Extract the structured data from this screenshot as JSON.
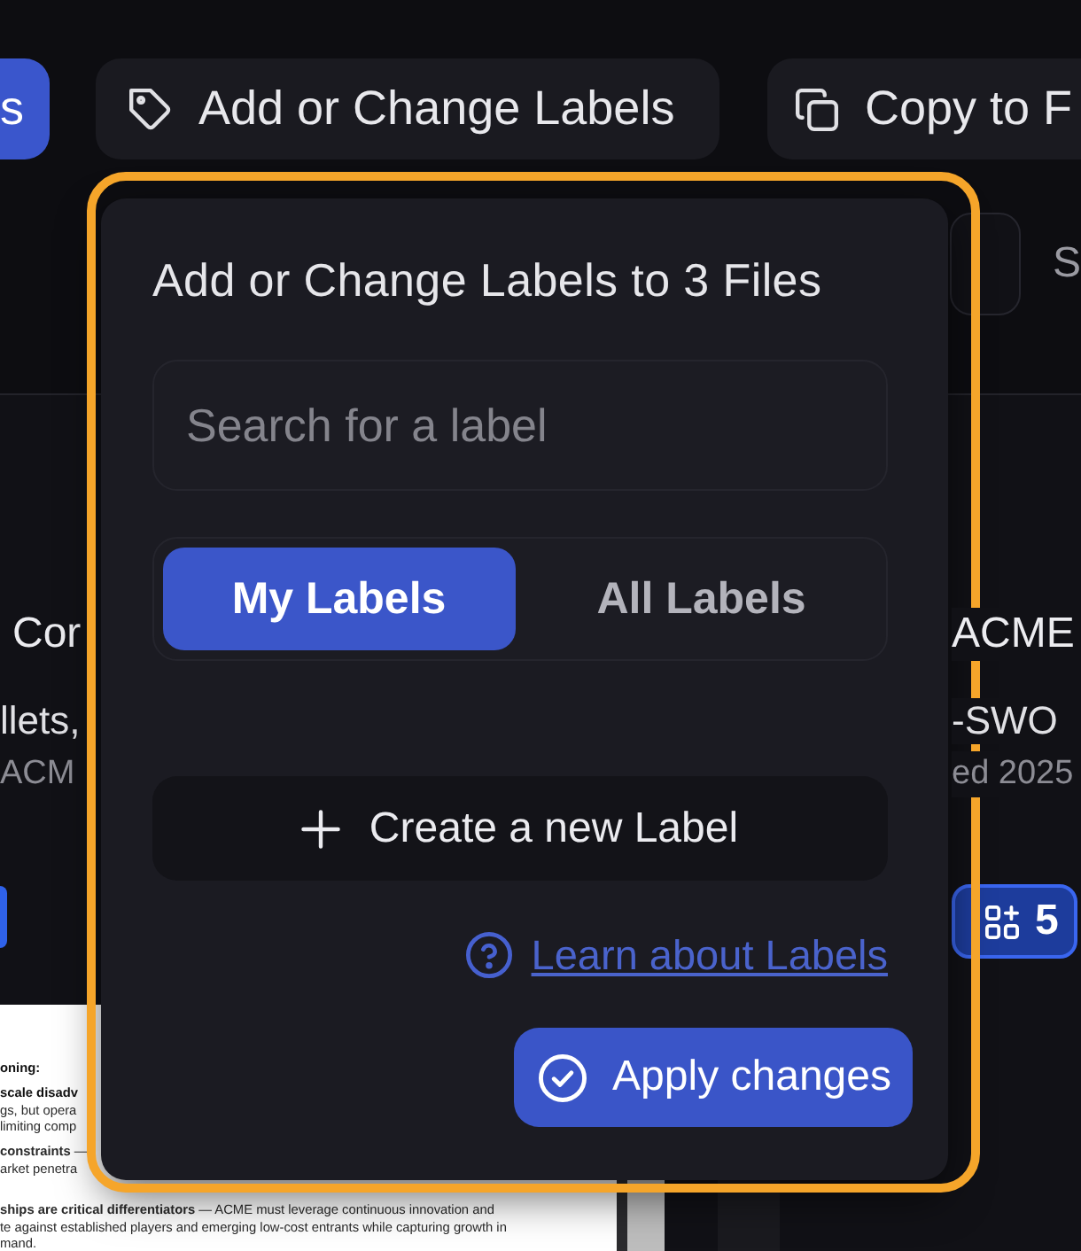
{
  "toolbar": {
    "buttons": [
      {
        "kind": "primary",
        "label": "s"
      },
      {
        "kind": "tag",
        "label": "Add or Change Labels"
      },
      {
        "kind": "copy",
        "label": "Copy to F"
      }
    ]
  },
  "filter_bar": {
    "label": "S"
  },
  "cards": [
    {
      "kind": "left",
      "title": "Cor",
      "line_1": "llets,",
      "line_2": "ACM"
    },
    {
      "kind": "right",
      "title": "ACME",
      "line_1": "-SWO",
      "line_2": "ed 2025",
      "badge": "5"
    }
  ],
  "document_preview": {
    "paragraphs": [
      {
        "lines": [
          {
            "text": "oning:",
            "bold": true
          }
        ]
      },
      {
        "lines": [
          {
            "text": "scale disadv",
            "bold": true
          },
          {
            "text": "gs, but opera",
            "bold": false
          },
          {
            "text": "limiting comp",
            "bold": false
          }
        ]
      },
      {
        "lines": [
          {
            "text": "**constraints** —",
            "bold": false
          },
          {
            "text": "arket penetra",
            "bold": false
          }
        ]
      },
      {
        "lines": [
          {
            "text": "**ships are critical differentiators** — ACME must leverage continuous innovation and",
            "bold": false
          },
          {
            "text": "te against established players and emerging low-cost entrants while capturing growth in",
            "bold": false
          },
          {
            "text": "mand.",
            "bold": false
          }
        ]
      }
    ]
  },
  "label_popup": {
    "highlighted": true,
    "title": "Add or Change Labels to 3 Files",
    "search": {
      "placeholder": "Search for a label"
    },
    "tabs": [
      {
        "label": "My Labels",
        "selected": true
      },
      {
        "label": "All Labels",
        "selected": false
      }
    ],
    "create_button": "Create a new Label",
    "help_link": "Learn about Labels",
    "apply_button": "Apply changes"
  }
}
